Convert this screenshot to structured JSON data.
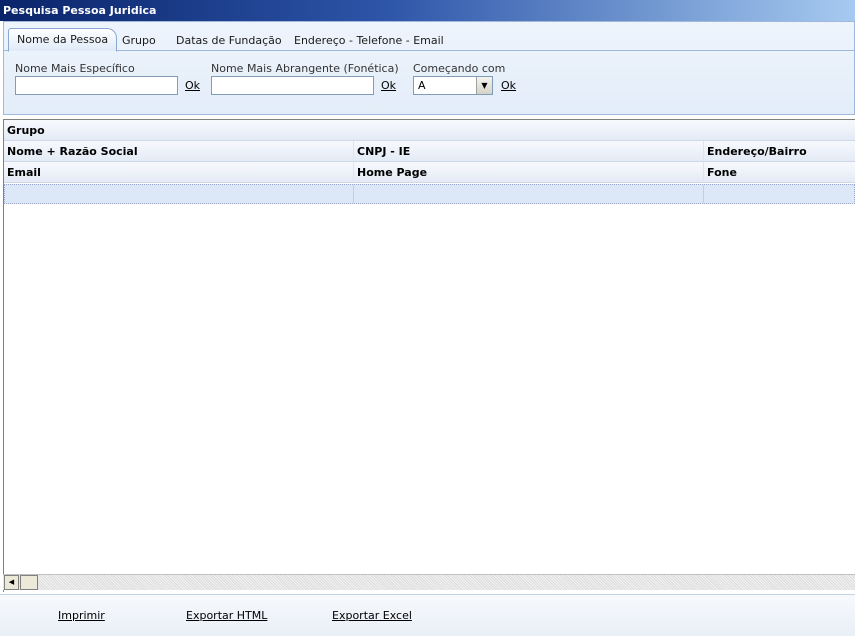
{
  "window": {
    "title": "Pesquisa Pessoa Juridica"
  },
  "tabs": [
    {
      "label": "Nome da Pessoa",
      "active": true
    },
    {
      "label": "Grupo",
      "active": false
    },
    {
      "label": "Datas de Fundação",
      "active": false
    },
    {
      "label": "Endereço - Telefone - Email",
      "active": false
    }
  ],
  "filters": {
    "specific": {
      "label": "Nome Mais Específico",
      "value": "",
      "ok": "Ok"
    },
    "broad": {
      "label": "Nome Mais Abrangente (Fonética)",
      "value": "",
      "ok": "Ok"
    },
    "starts_with": {
      "label": "Começando com",
      "selected": "A",
      "ok": "Ok"
    }
  },
  "grid": {
    "group_header": "Grupo",
    "header_row_1": [
      "Nome + Razão Social",
      "CNPJ - IE",
      "Endereço/Bairro"
    ],
    "header_row_2": [
      "Email",
      "Home Page",
      "Fone"
    ]
  },
  "footer": {
    "print": "Imprimir",
    "export_html": "Exportar HTML",
    "export_excel": "Exportar Excel"
  },
  "colors": {
    "title_start": "#0a246a",
    "title_end": "#a6caf0",
    "panel_bg": "#e3edf9",
    "selected_row": "#dce8f8"
  }
}
